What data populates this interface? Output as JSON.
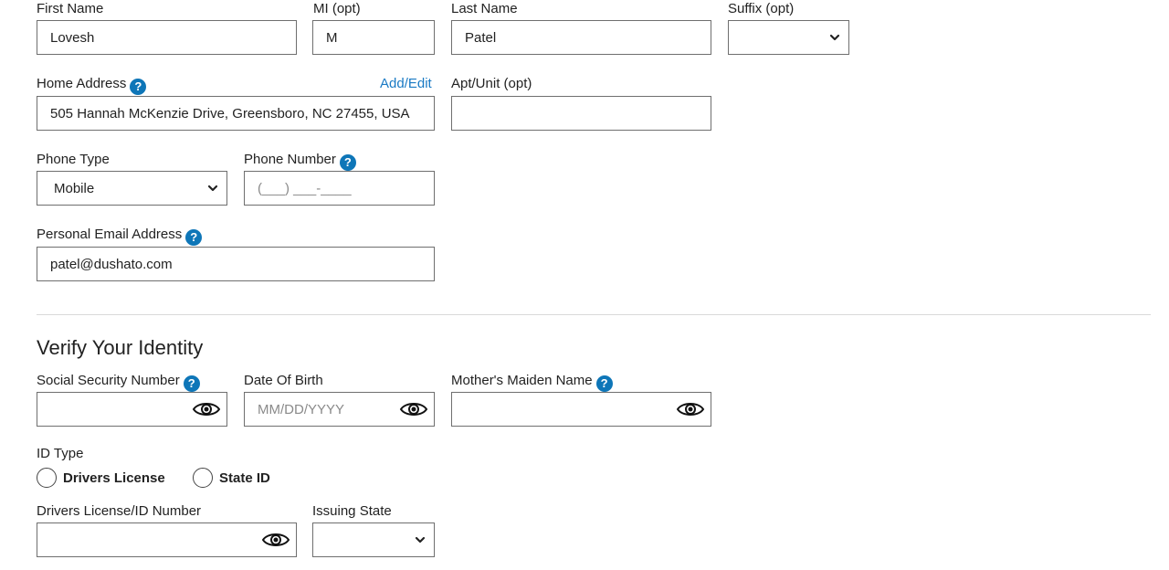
{
  "personal": {
    "first_name": {
      "label": "First Name",
      "value": "Lovesh"
    },
    "mi": {
      "label": "MI (opt)",
      "value": "M"
    },
    "last_name": {
      "label": "Last Name",
      "value": "Patel"
    },
    "suffix": {
      "label": "Suffix (opt)",
      "value": ""
    },
    "home_address": {
      "label": "Home Address",
      "help_icon": "question-circle-icon",
      "link": "Add/Edit",
      "value": "505 Hannah McKenzie Drive, Greensboro, NC 27455, USA"
    },
    "apt_unit": {
      "label": "Apt/Unit (opt)",
      "value": ""
    },
    "phone_type": {
      "label": "Phone Type",
      "value": "Mobile"
    },
    "phone_number": {
      "label": "Phone Number",
      "help_icon": "question-circle-icon",
      "placeholder": "(___) ___-____"
    },
    "email": {
      "label": "Personal Email Address",
      "help_icon": "question-circle-icon",
      "value": "patel@dushato.com"
    }
  },
  "identity": {
    "title": "Verify Your Identity",
    "ssn": {
      "label": "Social Security Number",
      "help_icon": "question-circle-icon",
      "value": "",
      "toggle_icon": "eye-icon"
    },
    "dob": {
      "label": "Date Of Birth",
      "placeholder": "MM/DD/YYYY",
      "toggle_icon": "eye-icon"
    },
    "maiden_name": {
      "label": "Mother's Maiden Name",
      "help_icon": "question-circle-icon",
      "value": "",
      "toggle_icon": "eye-icon"
    },
    "id_type": {
      "label": "ID Type",
      "options": [
        "Drivers License",
        "State ID"
      ],
      "selected": ""
    },
    "license_number": {
      "label": "Drivers License/ID Number",
      "value": "",
      "toggle_icon": "eye-icon"
    },
    "issuing_state": {
      "label": "Issuing State",
      "value": ""
    }
  },
  "colors": {
    "help_icon": "#0e76b8",
    "link": "#1a7ac4",
    "border": "#6f6f6f",
    "divider": "#d9d9d9"
  },
  "help_glyph": "?"
}
